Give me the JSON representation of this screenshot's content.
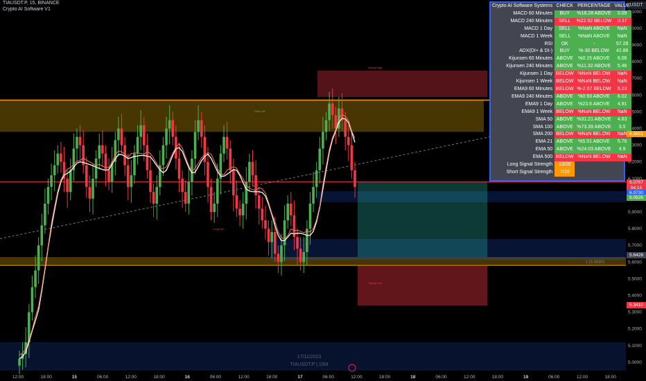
{
  "header": {
    "symbol_line": "TIAUSDT.P, 15, BINANCE",
    "indicator_line": "Crypto AI Software V1",
    "currency": "USDT"
  },
  "watermark": {
    "date": "17/11/2023",
    "symbol": "TIAUSDT.P | 15M"
  },
  "colors": {
    "bull": "#4caf50",
    "bear": "#f23645",
    "accent": "#ff9800",
    "panel_border": "#2962ff",
    "ma": "#ffffff"
  },
  "signal_table": {
    "headers": [
      "Crypto AI Software Systems",
      "CHECK",
      "PERCENTAGE",
      "VALUE"
    ],
    "rows": [
      {
        "name": "MACD 60 Minutes",
        "check": "BUY",
        "pct": "%18.28 ABOVE",
        "value": "0.09",
        "color": "g"
      },
      {
        "name": "MACD 240 Minutes",
        "check": "SELL",
        "pct": "%22.52 BELOW",
        "value": "0.37",
        "color": "r"
      },
      {
        "name": "MACD 1 Day",
        "check": "SELL",
        "pct": "%NaN ABOVE",
        "value": "NaN",
        "color": "g"
      },
      {
        "name": "MACD 1 Week",
        "check": "SELL",
        "pct": "%NaN ABOVE",
        "value": "NaN",
        "color": "g"
      },
      {
        "name": "RSI",
        "check": "OK",
        "pct": "-",
        "value": "57.28",
        "color": "g"
      },
      {
        "name": "ADX(DI+ & DI-)",
        "check": "BUY",
        "pct": "%-30 BELOW",
        "value": "42.86",
        "color": "g"
      },
      {
        "name": "Kijunsen 60 Minutes",
        "check": "ABOVE",
        "pct": "%0.15 ABOVE",
        "value": "6.06",
        "color": "g"
      },
      {
        "name": "Kijunsen 240 Minutes",
        "check": "ABOVE",
        "pct": "%11.32 ABOVE",
        "value": "5.46",
        "color": "g"
      },
      {
        "name": "Kijunsen 1 Day",
        "check": "BELOW",
        "pct": "%NaN BELOW",
        "value": "NaN",
        "color": "r"
      },
      {
        "name": "Kijunsen 1 Week",
        "check": "BELOW",
        "pct": "%NaN BELOW",
        "value": "NaN",
        "color": "r"
      },
      {
        "name": "EMA9 60 Minutes",
        "check": "BELOW",
        "pct": "%-2.67 BELOW",
        "value": "6.23",
        "color": "r"
      },
      {
        "name": "EMA9 240 Minutes",
        "check": "ABOVE",
        "pct": "%0.93 ABOVE",
        "value": "6.02",
        "color": "g"
      },
      {
        "name": "EMA9 1 Day",
        "check": "ABOVE",
        "pct": "%23.6 ABOVE",
        "value": "4.91",
        "color": "g"
      },
      {
        "name": "EMA9 1 Week",
        "check": "BELOW",
        "pct": "%NaN BELOW",
        "value": "NaN",
        "color": "r"
      },
      {
        "name": "SMA 50",
        "check": "ABOVE",
        "pct": "%31.21 ABOVE",
        "value": "4.63",
        "color": "g"
      },
      {
        "name": "SMA 100",
        "check": "ABOVE",
        "pct": "%73.39 ABOVE",
        "value": "3.5",
        "color": "g"
      },
      {
        "name": "SMA 200",
        "check": "BELOW",
        "pct": "%NaN BELOW",
        "value": "NaN",
        "color": "r"
      },
      {
        "name": "EMA 21",
        "check": "ABOVE",
        "pct": "%5.51 ABOVE",
        "value": "5.76",
        "color": "g"
      },
      {
        "name": "EMA 50",
        "check": "ABOVE",
        "pct": "%24.03 ABOVE",
        "value": "4.9",
        "color": "g"
      },
      {
        "name": "EMA 500",
        "check": "BELOW",
        "pct": "%NaN BELOW",
        "value": "NaN",
        "color": "r"
      }
    ],
    "long_label": "Long Signal Strength",
    "long_value": "13/20",
    "short_label": "Short Signal Strength",
    "short_value": "7/20"
  },
  "chart_data": {
    "type": "candlestick",
    "ylim": [
      4.95,
      7.12
    ],
    "y_ticks": [
      "7.1000",
      "7.0000",
      "6.9000",
      "6.8000",
      "6.7000",
      "6.6000",
      "6.5000",
      "6.4000",
      "6.3000",
      "6.2000",
      "6.1000",
      "6.0000",
      "5.9000",
      "5.8000",
      "5.7000",
      "5.6000",
      "5.5000",
      "5.4000",
      "5.3000",
      "5.2000",
      "5.1000",
      "5.0000"
    ],
    "x_ticks": [
      "12:00",
      "18:00",
      "15",
      "06:00",
      "12:00",
      "18:00",
      "16",
      "06:00",
      "12:00",
      "18:00",
      "17",
      "06:00",
      "12:00",
      "18:00",
      "18",
      "06:00",
      "12:00",
      "18:00",
      "19",
      "06:00",
      "12:00",
      "18:00"
    ],
    "price_tags": [
      {
        "label": "6.3681",
        "value": 6.3681,
        "color": "#ff9800"
      },
      {
        "label": "6.0767",
        "value": 6.0767,
        "color": "#f23645"
      },
      {
        "label": "04:15",
        "value": 6.045,
        "color": "#f23645"
      },
      {
        "label": "6.0730",
        "value": 6.013,
        "color": "#2962ff"
      },
      {
        "label": "6.0626",
        "value": 5.985,
        "color": "#4caf50"
      },
      {
        "label": "5.6428",
        "value": 5.6428,
        "color": "#434651"
      },
      {
        "label": "5.3410",
        "value": 5.341,
        "color": "#f23645"
      }
    ],
    "levels": {
      "resistance_top": 6.57,
      "resistance_bottom": 6.38,
      "support_top": 5.63,
      "support_bottom": 5.58,
      "red_line": 6.08
    },
    "position_label": "1 (5.5890)",
    "zone_labels": {
      "top": "Swing High",
      "mid_left": "Long Val",
      "resistance": "Daily HB",
      "entry": "Entry Bk",
      "stop": "Swing Low"
    },
    "candle_closes": [
      5.02,
      5.05,
      5.12,
      5.3,
      5.45,
      5.55,
      5.7,
      5.82,
      5.95,
      6.05,
      6.12,
      6.18,
      6.25,
      6.2,
      6.1,
      6.02,
      6.15,
      6.28,
      6.35,
      6.3,
      6.18,
      6.05,
      5.98,
      6.1,
      6.22,
      6.3,
      6.25,
      6.15,
      6.08,
      6.2,
      6.33,
      6.4,
      6.3,
      6.18,
      6.05,
      6.12,
      6.25,
      6.35,
      6.42,
      6.3,
      6.15,
      6.02,
      5.95,
      6.05,
      6.18,
      6.3,
      6.4,
      6.45,
      6.35,
      6.22,
      6.1,
      6.02,
      5.95,
      6.08,
      6.22,
      6.38,
      6.45,
      6.35,
      6.2,
      6.05,
      5.9,
      5.95,
      6.1,
      6.25,
      6.35,
      6.28,
      6.15,
      6.0,
      5.92,
      5.88,
      5.95,
      6.08,
      6.2,
      6.12,
      6.0,
      5.92,
      5.85,
      5.8,
      5.72,
      5.78,
      5.65,
      5.6,
      5.7,
      5.85,
      5.95,
      5.88,
      5.75,
      5.68,
      5.6,
      5.66,
      5.8,
      5.95,
      6.05,
      6.15,
      6.28,
      6.38,
      6.45,
      6.55,
      6.48,
      6.4,
      6.52,
      6.45,
      6.35,
      6.3,
      6.15,
      6.05
    ]
  }
}
